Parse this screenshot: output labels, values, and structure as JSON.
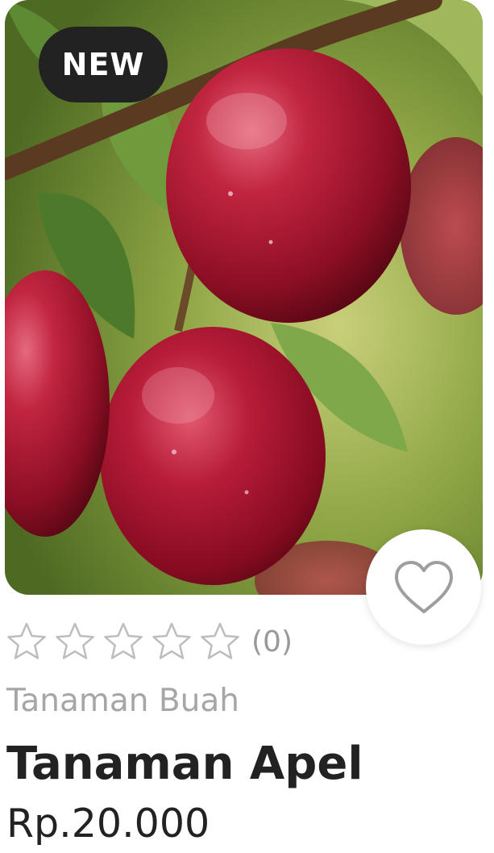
{
  "card": {
    "badge": "NEW",
    "image_alt": "Red apples on a branch",
    "rating": {
      "stars": 0,
      "max_stars": 5,
      "count_label": "(0)"
    },
    "category": "Tanaman Buah",
    "name": "Tanaman Apel",
    "price": "Rp.20.000",
    "favorite_icon": "heart-outline-icon"
  },
  "colors": {
    "badge_bg": "#222222",
    "text_dark": "#222222",
    "text_muted": "#a6a6a6",
    "star_outline": "#bdbdbd",
    "heart_outline": "#9e9e9e"
  }
}
